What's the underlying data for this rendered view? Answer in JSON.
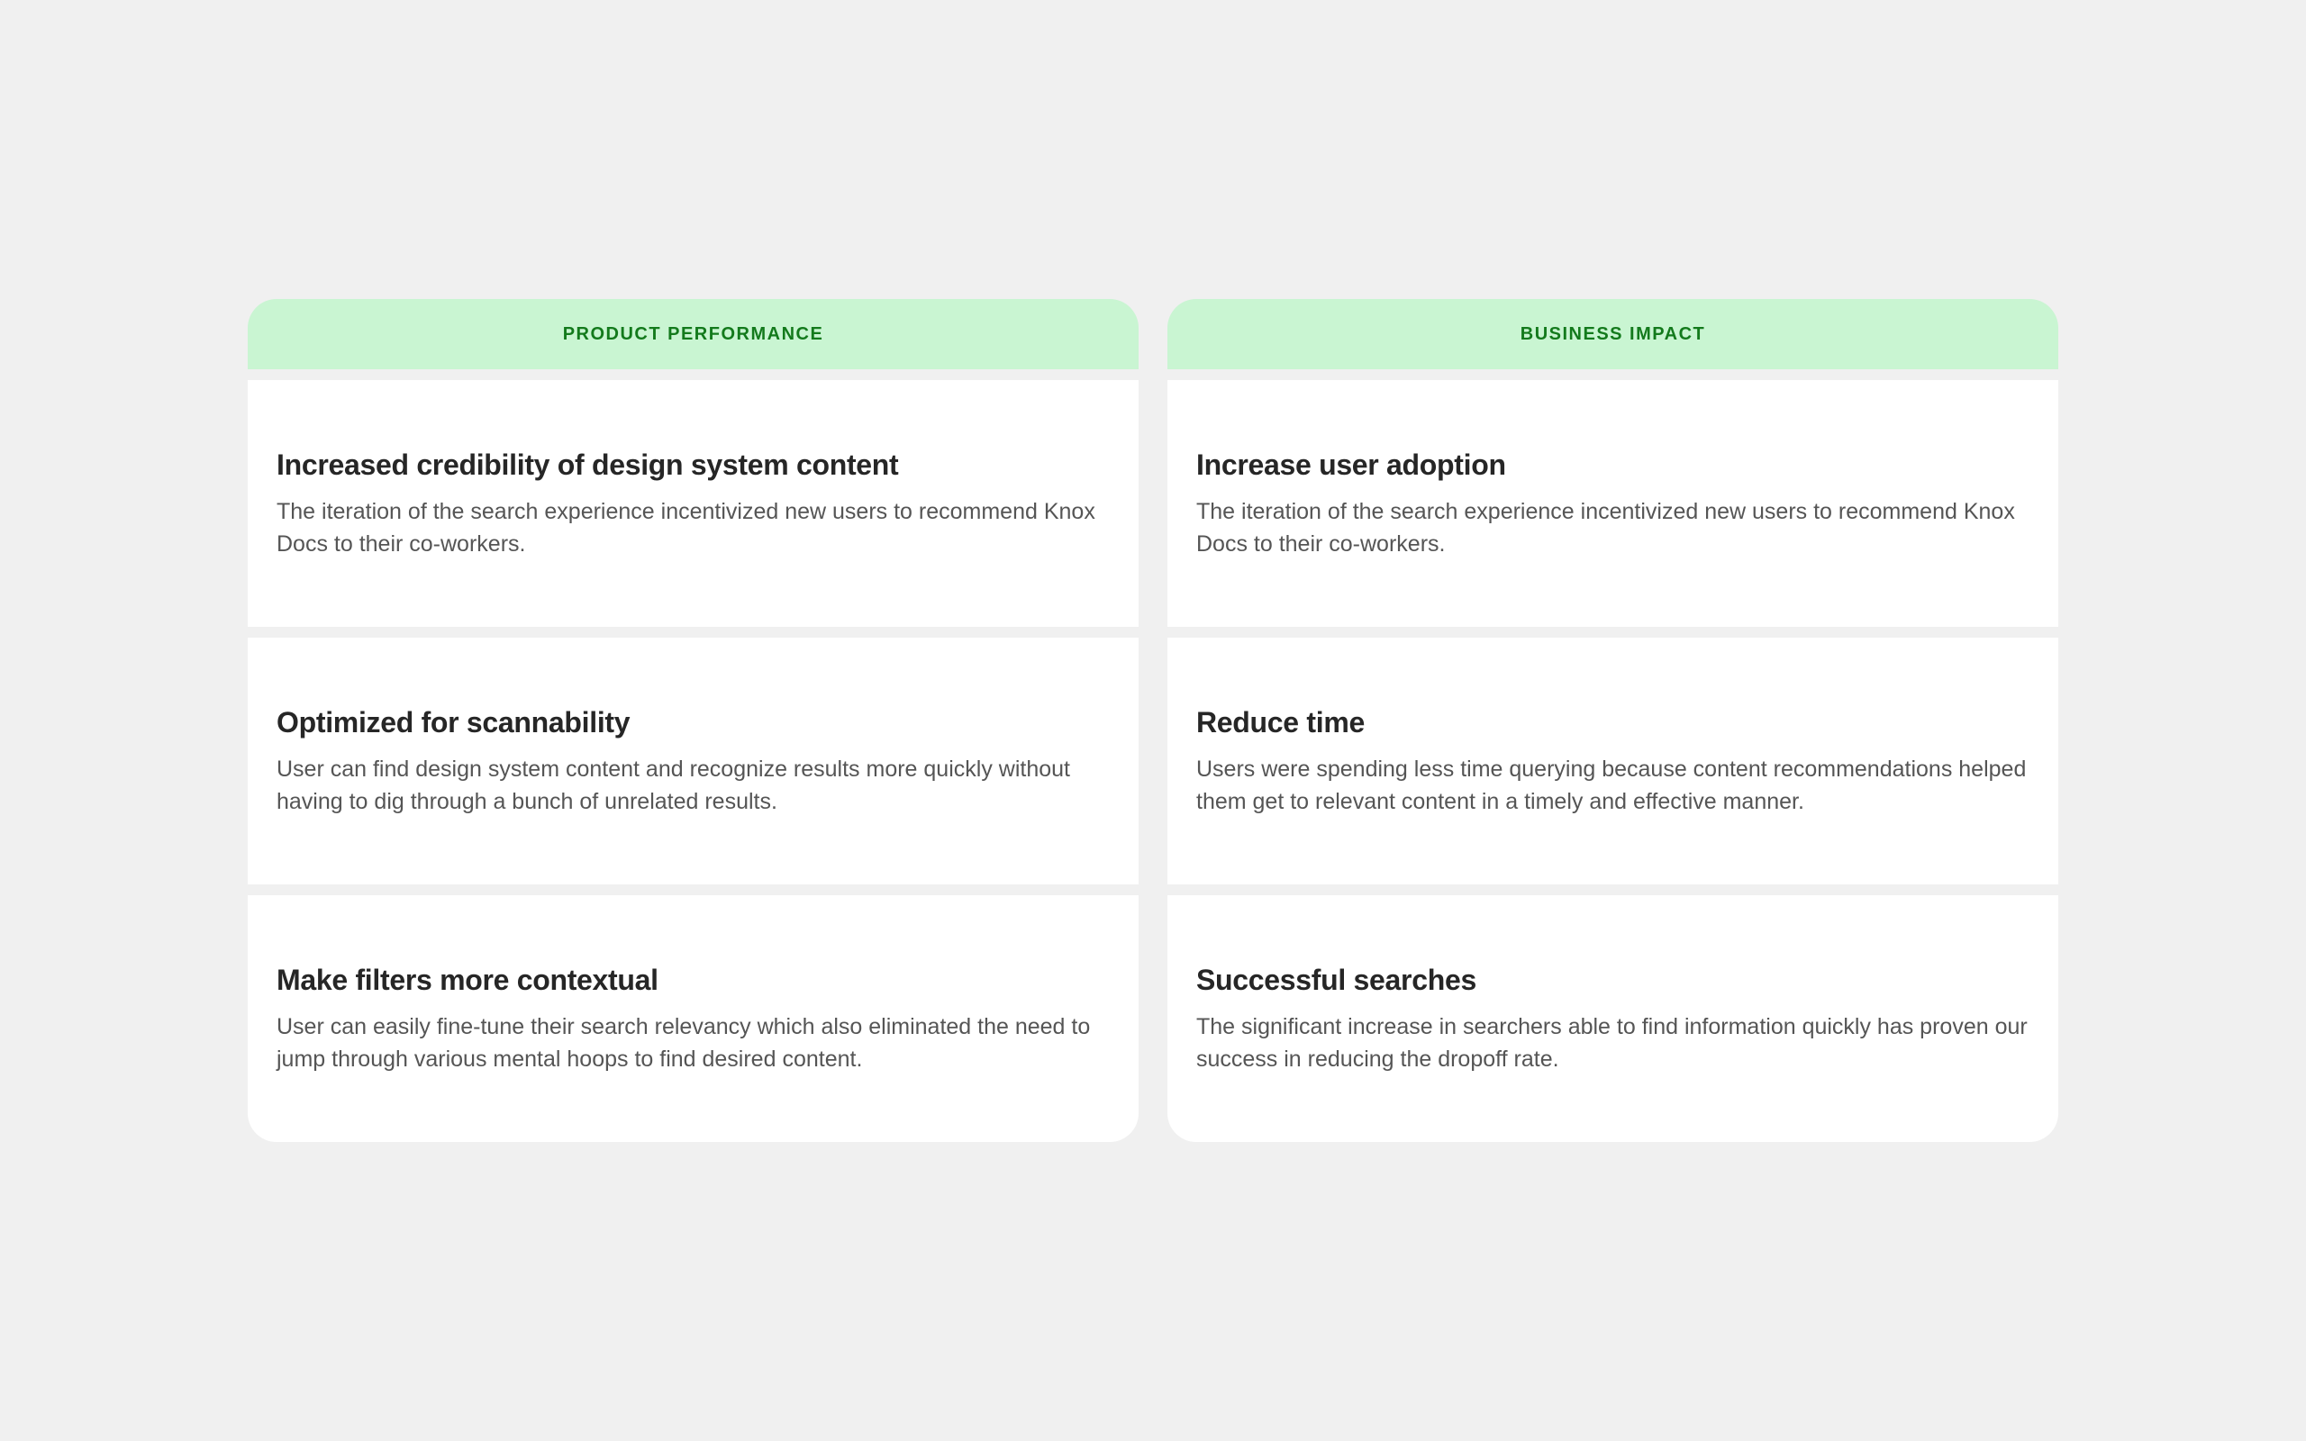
{
  "columns": [
    {
      "header": "PRODUCT PERFORMANCE",
      "cards": [
        {
          "title": "Increased credibility of design system content",
          "body": "The iteration of the search experience incentivized new users to recommend Knox Docs to their co-workers."
        },
        {
          "title": "Optimized for scannability",
          "body": "User can find design system content and recognize results more quickly without having to dig through a bunch of unrelated results."
        },
        {
          "title": "Make filters more contextual",
          "body": "User can easily fine-tune their search relevancy which also eliminated the need to jump through various mental hoops to find desired content."
        }
      ]
    },
    {
      "header": "BUSINESS IMPACT",
      "cards": [
        {
          "title": "Increase user adoption",
          "body": "The iteration of the search experience incentivized new users to recommend Knox Docs to their co-workers."
        },
        {
          "title": "Reduce time",
          "body": "Users were spending less time querying because content recommendations helped them get to relevant content in a timely and effective manner."
        },
        {
          "title": "Successful searches",
          "body": "The significant increase in searchers able to find information quickly has proven our success in reducing the dropoff rate."
        }
      ]
    }
  ],
  "colors": {
    "background": "#f0f0f0",
    "header_bg": "#c9f5d2",
    "header_text": "#137a1c",
    "card_bg": "#ffffff",
    "title_text": "#262626",
    "body_text": "#555555"
  }
}
